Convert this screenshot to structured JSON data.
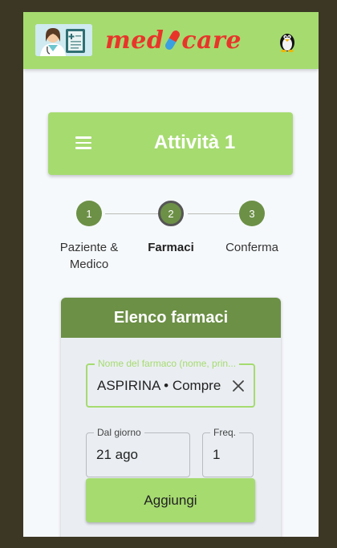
{
  "appbar": {
    "brand_left": "med",
    "brand_right": "care",
    "logo_icon": "doctor-clipboard-icon",
    "avatar_icon": "penguin-avatar-icon"
  },
  "title_card": {
    "title": "Attività 1",
    "menu_icon": "hamburger-menu-icon"
  },
  "stepper": {
    "steps": [
      {
        "number": "1",
        "label": "Paziente & Medico",
        "active": false
      },
      {
        "number": "2",
        "label": "Farmaci",
        "active": true
      },
      {
        "number": "3",
        "label": "Conferma",
        "active": false
      }
    ]
  },
  "drug_form": {
    "header": "Elenco farmaci",
    "drug_name_label": "Nome del farmaco (nome, prin...",
    "drug_name_value": "ASPIRINA • Compress",
    "from_day_label": "Dal giorno",
    "from_day_value": "21 ago",
    "freq_label": "Freq.",
    "freq_value": "1",
    "add_button": "Aggiungi"
  },
  "colors": {
    "primary": "#a6db70",
    "primary_dark": "#6c9046",
    "brand_red": "#e8352a",
    "background": "#f6f9fc"
  }
}
